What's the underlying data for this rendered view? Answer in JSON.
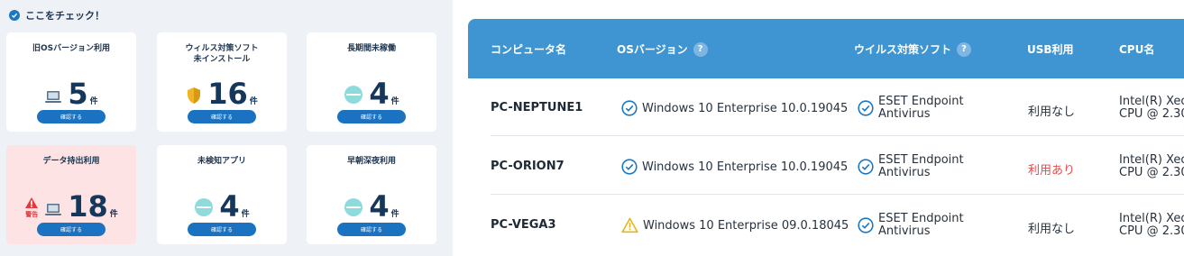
{
  "left": {
    "title": "ここをチェック！",
    "cards": [
      {
        "title": "旧OSバージョン利用",
        "icon": "laptop-icon",
        "count": "5",
        "unit": "件",
        "button": "確認する"
      },
      {
        "title": "ウィルス対策ソフト\n未インストール",
        "icon": "shield-icon",
        "count": "16",
        "unit": "件",
        "button": "確認する"
      },
      {
        "title": "長期間未稼働",
        "icon": "pill-icon",
        "count": "4",
        "unit": "件",
        "button": "確認する"
      },
      {
        "title": "データ持出利用",
        "icon": "laptop-icon",
        "warn_label": "警告",
        "count": "18",
        "unit": "件",
        "button": "確認する"
      },
      {
        "title": "未検知アプリ",
        "icon": "pill-icon",
        "count": "4",
        "unit": "件",
        "button": "確認する"
      },
      {
        "title": "早朝深夜利用",
        "icon": "pill-icon",
        "count": "4",
        "unit": "件",
        "button": "確認する"
      }
    ]
  },
  "table": {
    "headers": {
      "computer": "コンピュータ名",
      "os": "OSバージョン",
      "av": "ウイルス対策ソフト",
      "usb": "USB利用",
      "cpu": "CPU名"
    },
    "help": "?",
    "rows": [
      {
        "computer": "PC-NEPTUNE1",
        "os_status": "ok",
        "os": "Windows 10 Enterprise 10.0.19045",
        "av1": "ESET Endpoint",
        "av2": "Antivirus",
        "usb": "利用なし",
        "usb_status": "no",
        "cpu1": "Intel(R) Xeo",
        "cpu2": "CPU @ 2.30"
      },
      {
        "computer": "PC-ORION7",
        "os_status": "ok",
        "os": "Windows 10 Enterprise 10.0.19045",
        "av1": "ESET Endpoint",
        "av2": "Antivirus",
        "usb": "利用あり",
        "usb_status": "yes",
        "cpu1": "Intel(R) Xeo",
        "cpu2": "CPU @ 2.30"
      },
      {
        "computer": "PC-VEGA3",
        "os_status": "warn",
        "os": "Windows 10 Enterprise 09.0.18045",
        "av1": "ESET Endpoint",
        "av2": "Antivirus",
        "usb": "利用なし",
        "usb_status": "no",
        "cpu1": "Intel(R) Xeo",
        "cpu2": "CPU @ 2.30"
      }
    ]
  },
  "colors": {
    "header_bg": "#3f95d2",
    "button_bg": "#1b72c0",
    "warn_card_bg": "#fde3e3",
    "alert_red": "#e84a4a"
  }
}
